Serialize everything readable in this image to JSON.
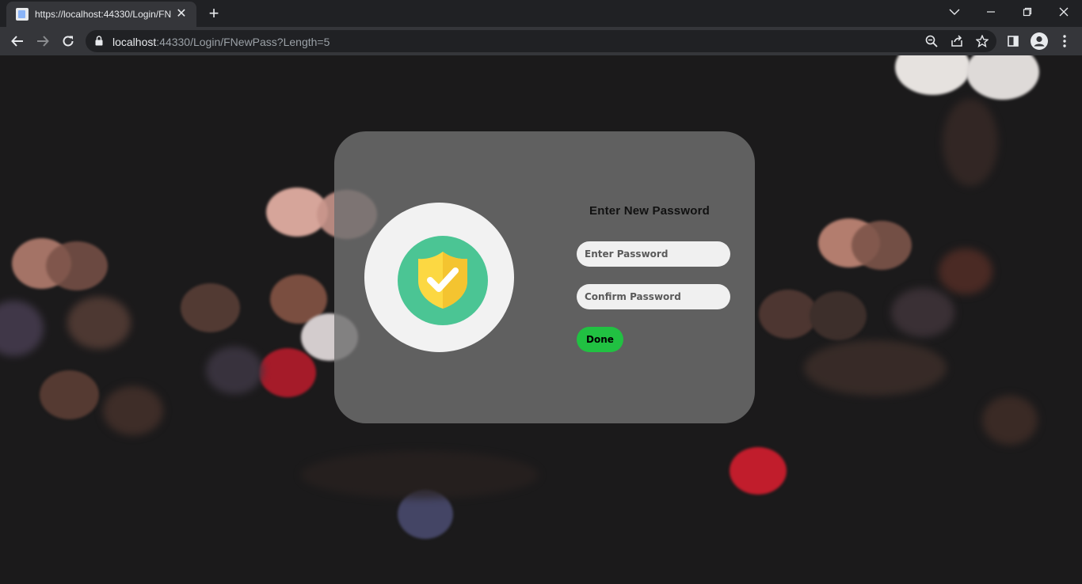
{
  "browser": {
    "tab_title": "https://localhost:44330/Login/FNewPass?Length=5",
    "url_host": "localhost",
    "url_rest": ":44330/Login/FNewPass?Length=5",
    "new_tab_glyph": "+",
    "tab_close_glyph": "✕"
  },
  "form": {
    "title": "Enter New Password",
    "password_placeholder": "Enter Password",
    "confirm_placeholder": "Confirm Password",
    "done_label": "Done"
  },
  "icons": {
    "shield": "shield-check-icon"
  },
  "colors": {
    "shield_disc": "#4bc594",
    "shield_yellow": "#fcd842",
    "done_button": "#21c142",
    "card": "#707070"
  }
}
